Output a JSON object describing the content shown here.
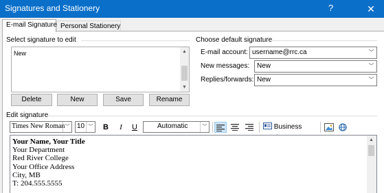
{
  "window": {
    "title": "Signatures and Stationery",
    "help": "?",
    "close": "✕"
  },
  "tabs": [
    {
      "label": "E-mail Signature"
    },
    {
      "label": "Personal Stationery"
    }
  ],
  "select_signature": {
    "label": "Select signature to edit",
    "items": [
      "New"
    ],
    "buttons": {
      "delete": "Delete",
      "new": "New",
      "save": "Save",
      "rename": "Rename"
    }
  },
  "default_signature": {
    "label": "Choose default signature",
    "email_account_label": "E-mail account:",
    "email_account_value": "username@rrc.ca",
    "new_messages_label": "New messages:",
    "new_messages_value": "New",
    "replies_label": "Replies/forwards:",
    "replies_value": "New"
  },
  "edit_signature": {
    "label": "Edit signature",
    "toolbar": {
      "font": "Times New Roman",
      "size": "10",
      "bold": "B",
      "italic": "I",
      "underline": "U",
      "color": "Automatic",
      "business_card": "Business Card"
    },
    "lines": [
      "Your Name, Your Title",
      "Your Department",
      "Red River College",
      "Your Office Address",
      "City, MB",
      "T: 204.555.5555"
    ]
  }
}
